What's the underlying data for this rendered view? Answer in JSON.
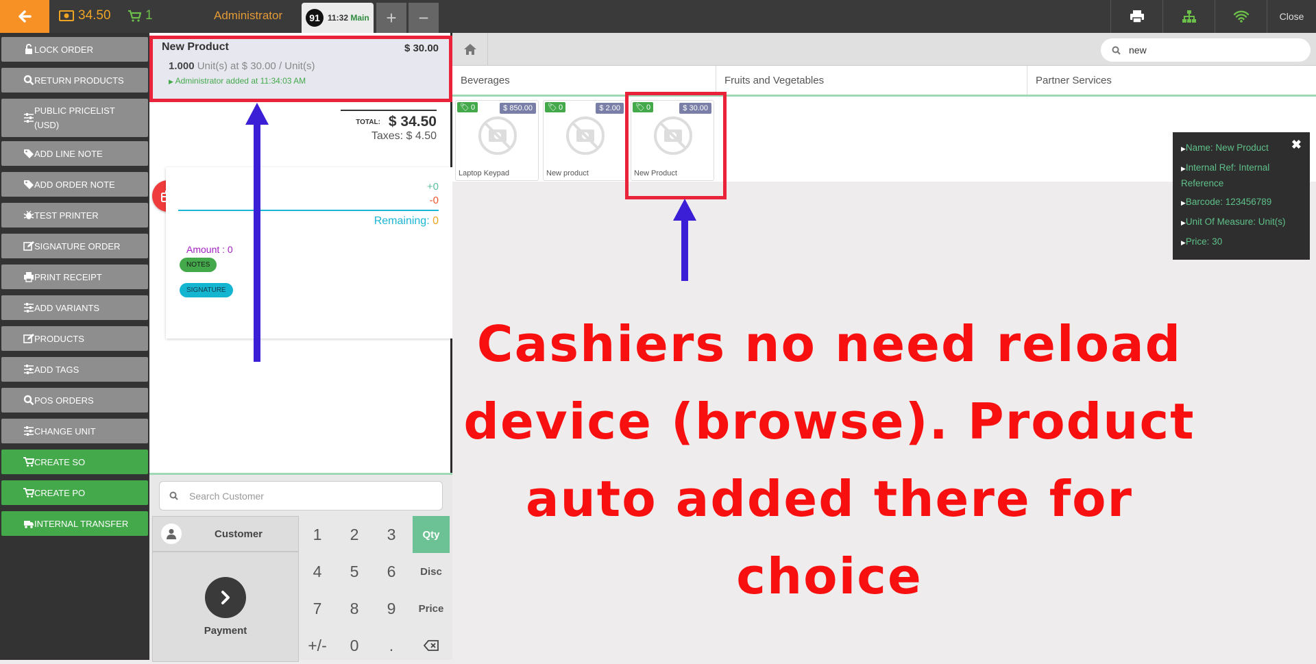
{
  "topbar": {
    "amount": "34.50",
    "cart_count": "1",
    "user": "Administrator",
    "order_number": "91",
    "order_time": "11:32",
    "order_label": "Main",
    "close_label": "Close"
  },
  "sidebar": {
    "items": [
      {
        "label": "LOCK ORDER",
        "icon": "unlock-icon"
      },
      {
        "label": "RETURN PRODUCTS",
        "icon": "search-icon"
      },
      {
        "label": "PUBLIC PRICELIST (USD)",
        "icon": "sliders-icon"
      },
      {
        "label": "ADD LINE NOTE",
        "icon": "tag-icon"
      },
      {
        "label": "ADD ORDER NOTE",
        "icon": "tag-icon"
      },
      {
        "label": "TEST PRINTER",
        "icon": "bug-icon"
      },
      {
        "label": "SIGNATURE ORDER",
        "icon": "edit-icon"
      },
      {
        "label": "PRINT RECEIPT",
        "icon": "printer-icon"
      },
      {
        "label": "ADD VARIANTS",
        "icon": "sliders-icon"
      },
      {
        "label": "PRODUCTS",
        "icon": "edit-icon"
      },
      {
        "label": "ADD TAGS",
        "icon": "sliders-icon"
      },
      {
        "label": "POS ORDERS",
        "icon": "search-icon"
      },
      {
        "label": "CHANGE UNIT",
        "icon": "sliders-icon"
      },
      {
        "label": "CREATE SO",
        "icon": "cart-icon"
      },
      {
        "label": "CREATE PO",
        "icon": "cart-icon"
      },
      {
        "label": "INTERNAL TRANSFER",
        "icon": "truck-icon"
      }
    ]
  },
  "order": {
    "line": {
      "name": "New Product",
      "price": "$ 30.00",
      "qty": "1.000",
      "qty_desc": "Unit(s) at $ 30.00 / Unit(s)",
      "note": "Administrator added at 11:34:03 AM"
    },
    "total_label": "TOTAL:",
    "total": "$ 34.50",
    "taxes": "Taxes: $ 4.50",
    "plus": "+0",
    "minus": "-0",
    "remaining_label": "Remaining:",
    "remaining_value": "0",
    "amount": "Amount : 0",
    "notes_label": "NOTES",
    "signature_label": "SIGNATURE"
  },
  "customer": {
    "search_placeholder": "Search Customer",
    "customer_label": "Customer",
    "payment_label": "Payment"
  },
  "numpad": {
    "keys": [
      "1",
      "2",
      "3",
      "4",
      "5",
      "6",
      "7",
      "8",
      "9",
      "+/-",
      "0",
      "."
    ],
    "modes": [
      "Qty",
      "Disc",
      "Price"
    ],
    "active_mode": "Qty"
  },
  "products": {
    "search_value": "new",
    "categories": [
      "Beverages",
      "Fruits and Vegetables",
      "Partner Services"
    ],
    "items": [
      {
        "name": "Laptop Keypad",
        "price": "$ 850.00",
        "tag": "0"
      },
      {
        "name": "New product",
        "price": "$ 2.00",
        "tag": "0"
      },
      {
        "name": "New Product",
        "price": "$ 30.00",
        "tag": "0"
      }
    ]
  },
  "info_popup": {
    "lines": [
      "Name: New Product",
      "Internal Ref: Internal Reference",
      "Barcode: 123456789",
      "Unit Of Measure: Unit(s)",
      "Price: 30"
    ]
  },
  "annotation": {
    "lines": [
      "Cashiers no need reload",
      "device (browse). Product",
      "auto added there for choice"
    ],
    "highlight_color": "#e8233a",
    "arrow_color": "#3a1fd6"
  }
}
